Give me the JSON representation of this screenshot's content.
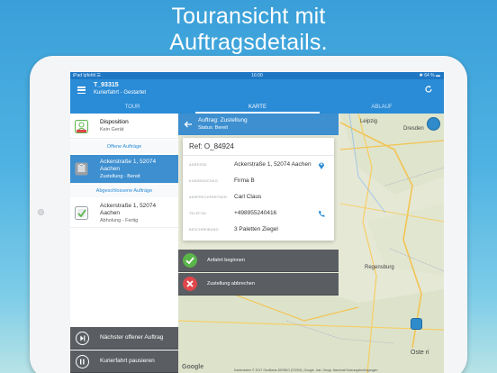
{
  "headline": {
    "line1": "Touransicht mit",
    "line2": "Auftragsdetails."
  },
  "statusbar": {
    "left": "iPad Ipfehlt ☰",
    "time": "16:00",
    "right": "✱ 64 % ▬"
  },
  "appbar": {
    "title": "T_93315",
    "subtitle": "Kurierfahrt - Gestartet"
  },
  "tabs": [
    {
      "label": "TOUR",
      "active": false
    },
    {
      "label": "KARTE",
      "active": true
    },
    {
      "label": "ABLAUF",
      "active": false
    }
  ],
  "sidebar": {
    "disposition": {
      "title": "Disposition",
      "subtitle": "Kein Gerät",
      "icon": "disposition-user-icon"
    },
    "open_section": "Offene Aufträge",
    "open_item": {
      "line1": "Ackerstraße 1, 52074",
      "line2": "Aachen",
      "line3": "Zustellung - Bereit",
      "icon": "box-icon"
    },
    "closed_section": "Abgeschlossene Aufträge",
    "closed_item": {
      "line1": "Ackerstraße 1, 52074",
      "line2": "Aachen",
      "line3": "Abholung - Fertig",
      "icon": "check-icon"
    },
    "next_button": "Nächster offener Auftrag",
    "pause_button": "Kurierfahrt pausieren"
  },
  "detail": {
    "title": "Auftrag: Zustellung",
    "status": "Status: Bereit",
    "ref": "Ref: O_84924",
    "fields": [
      {
        "label": "ADRESSE",
        "value": "Ackerstraße 1, 52074 Aachen",
        "icon": "location-pin-icon"
      },
      {
        "label": "KUNDENSCHILD",
        "value": "Firma B",
        "icon": ""
      },
      {
        "label": "ANSPRECHPARTNER",
        "value": "Carl Claus",
        "icon": ""
      },
      {
        "label": "TELEFON",
        "value": "+498955240416",
        "icon": "phone-icon"
      },
      {
        "label": "BESCHREIBUNG",
        "value": "3 Paletten Ziegel",
        "icon": ""
      }
    ],
    "actions": [
      {
        "label": "Anfahrt beginnen",
        "color": "#5ab54a",
        "icon": "check-circle-icon"
      },
      {
        "label": "Zustellung abbrechen",
        "color": "#e0474c",
        "icon": "cancel-circle-icon"
      }
    ]
  },
  "map": {
    "labels": [
      "Leipzig",
      "Dresden",
      "Regensburg",
      "Ost­e ri",
      "Google"
    ],
    "attribution": "Kartendaten © 2017 GeoBasis-DE/BKG (©2009), Google, Inst. Geogr. Nacional   Nutzungsbedingungen"
  },
  "colors": {
    "primary": "#2a8bd6",
    "selected": "#3d8fd0",
    "dark_button": "#5a5e62"
  }
}
